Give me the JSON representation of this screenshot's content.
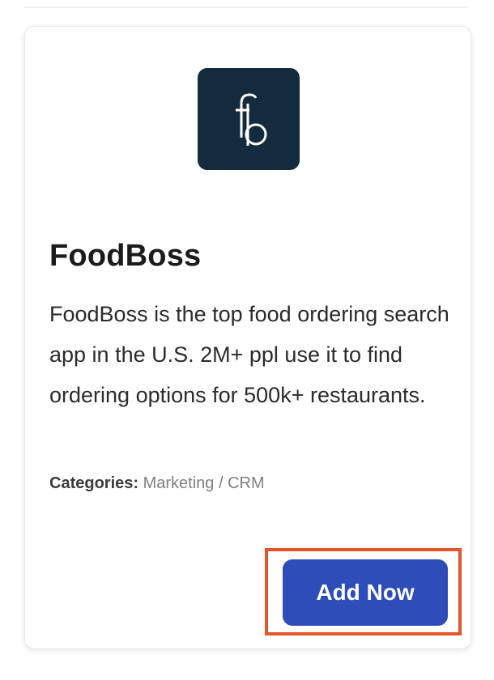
{
  "app": {
    "name": "FoodBoss",
    "description": "FoodBoss is the top food ordering search app in the U.S. 2M+ ppl use it to find ordering options for 500k+ restaurants.",
    "categories_label": "Categories:",
    "categories_value": "Marketing / CRM",
    "logo_text": "fb",
    "logo_bg_color": "#132b3c"
  },
  "actions": {
    "add_label": "Add Now",
    "button_color": "#2f4db8",
    "highlight_color": "#e4562a"
  }
}
